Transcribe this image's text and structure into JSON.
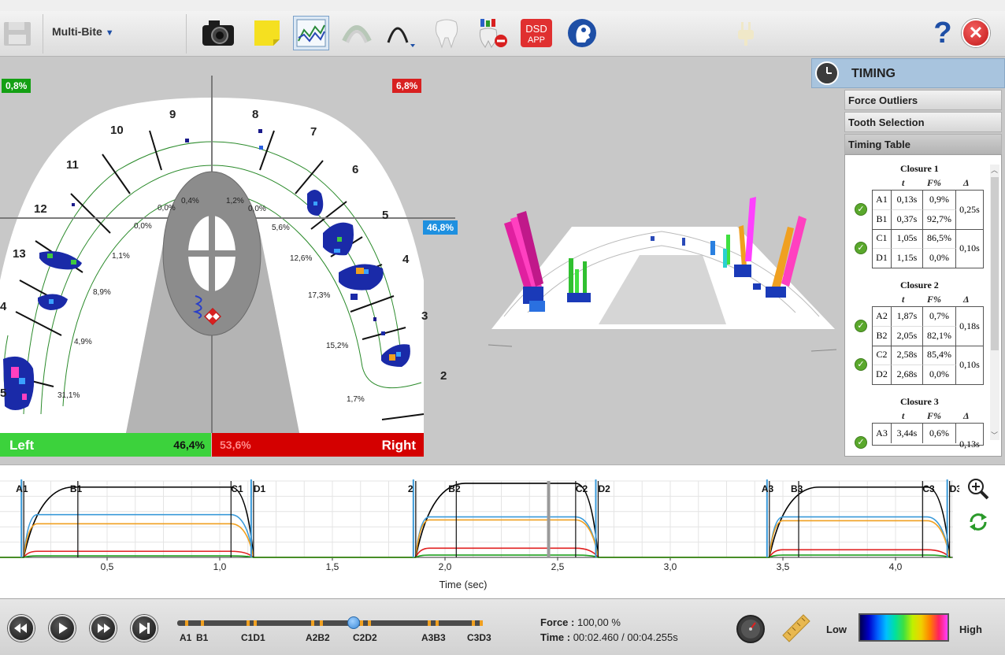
{
  "toolbar": {
    "mode_label": "Multi-Bite",
    "icons": [
      "save-icon",
      "camera-icon",
      "note-icon",
      "graph-icon",
      "arch-overlay-icon",
      "arch-curve-icon",
      "tooth-icon",
      "tooth-remove-icon",
      "dsd-app-icon",
      "head-icon",
      "plug-icon",
      "help-icon",
      "close-icon"
    ],
    "dsd_line1": "DSD",
    "dsd_line2": "APP",
    "help_glyph": "?",
    "close_glyph": "✕"
  },
  "arch": {
    "top_left_pct": "0,8%",
    "top_right_pct": "6,8%",
    "right_side_pct": "46,8%",
    "tooth_numbers": [
      "9",
      "8",
      "10",
      "7",
      "11",
      "6",
      "12",
      "5",
      "13",
      "4",
      "4",
      "3",
      "5",
      "2"
    ],
    "region_pcts": [
      "0,4%",
      "1,2%",
      "0,0%",
      "0,0%",
      "0,0%",
      "5,6%",
      "1,1%",
      "12,6%",
      "8,9%",
      "17,3%",
      "4,9%",
      "15,2%",
      "31,1%",
      "1,7%"
    ],
    "colors": {
      "left": "#3cd23c",
      "right": "#d40000",
      "badge_blue": "#1e90e0",
      "badge_green": "#13a013"
    }
  },
  "balance": {
    "left_label": "Left",
    "left_value": "46,4%",
    "right_value": "53,6%",
    "right_label": "Right"
  },
  "timing_panel": {
    "title": "TIMING",
    "sections": [
      "Force Outliers",
      "Tooth Selection",
      "Timing Table"
    ],
    "col_t": "t",
    "col_f": "F%",
    "col_delta": "Δ",
    "closures": [
      {
        "title": "Closure 1",
        "rows": [
          {
            "label": "A1",
            "t": "0,13s",
            "f": "0,9%"
          },
          {
            "label": "B1",
            "t": "0,37s",
            "f": "92,7%"
          },
          {
            "label": "C1",
            "t": "1,05s",
            "f": "86,5%"
          },
          {
            "label": "D1",
            "t": "1,15s",
            "f": "0,0%"
          }
        ],
        "deltas": [
          "0,25s",
          "0,10s"
        ]
      },
      {
        "title": "Closure 2",
        "rows": [
          {
            "label": "A2",
            "t": "1,87s",
            "f": "0,7%"
          },
          {
            "label": "B2",
            "t": "2,05s",
            "f": "82,1%"
          },
          {
            "label": "C2",
            "t": "2,58s",
            "f": "85,4%"
          },
          {
            "label": "D2",
            "t": "2,68s",
            "f": "0,0%"
          }
        ],
        "deltas": [
          "0,18s",
          "0,10s"
        ]
      },
      {
        "title": "Closure 3",
        "rows": [
          {
            "label": "A3",
            "t": "3,44s",
            "f": "0,6%"
          }
        ],
        "deltas": [
          "0,13s"
        ]
      }
    ]
  },
  "chart_data": {
    "type": "line",
    "xlabel": "Time (sec)",
    "ylabel": "",
    "xlim": [
      0,
      4.25
    ],
    "ylim": [
      0,
      100
    ],
    "x_ticks": [
      0.5,
      1.0,
      1.5,
      2.0,
      2.5,
      3.0,
      3.5,
      4.0
    ],
    "tick_labels": [
      "0,5",
      "1,0",
      "1,5",
      "2,0",
      "2,5",
      "3,0",
      "3,5",
      "4,0"
    ],
    "cursor_time": 2.46,
    "markers": [
      {
        "label": "A1",
        "t": 0.13
      },
      {
        "label": "B1",
        "t": 0.37
      },
      {
        "label": "C1",
        "t": 1.05
      },
      {
        "label": "D1",
        "t": 1.15
      },
      {
        "label": "A2",
        "t": 1.87
      },
      {
        "label": "B2",
        "t": 2.05
      },
      {
        "label": "C2",
        "t": 2.58
      },
      {
        "label": "D2",
        "t": 2.68
      },
      {
        "label": "A3",
        "t": 3.44
      },
      {
        "label": "B3",
        "t": 3.57
      },
      {
        "label": "C3",
        "t": 4.12
      },
      {
        "label": "D3",
        "t": 4.24
      }
    ],
    "marker_labels_shown": [
      "A1",
      "B1",
      "C1",
      "D1",
      "2",
      "B2",
      "C2",
      "D2",
      "A3",
      "B3",
      "C3",
      "D3"
    ],
    "series": [
      {
        "color": "#000000",
        "values_desc": "total force",
        "plateaus": [
          [
            0.13,
            1.15,
            92
          ],
          [
            1.87,
            2.68,
            97
          ],
          [
            3.44,
            4.24,
            92
          ]
        ]
      },
      {
        "color": "#3a9ad9",
        "values_desc": "blue",
        "plateaus": [
          [
            0.13,
            1.15,
            56
          ],
          [
            1.87,
            2.68,
            53
          ],
          [
            3.44,
            4.24,
            53
          ]
        ]
      },
      {
        "color": "#f0a020",
        "values_desc": "orange",
        "plateaus": [
          [
            0.13,
            1.15,
            44
          ],
          [
            1.87,
            2.68,
            49
          ],
          [
            3.44,
            4.24,
            48
          ]
        ]
      },
      {
        "color": "#e02020",
        "values_desc": "red",
        "plateaus": [
          [
            0.13,
            1.15,
            8
          ],
          [
            1.87,
            2.68,
            12
          ],
          [
            3.44,
            4.24,
            10
          ]
        ]
      },
      {
        "color": "#20a020",
        "values_desc": "green",
        "plateaus": [
          [
            0.13,
            1.15,
            2
          ],
          [
            1.87,
            2.68,
            3
          ],
          [
            3.44,
            4.24,
            3
          ]
        ]
      }
    ]
  },
  "controls": {
    "timeline_labels": [
      "A1",
      "B1",
      "C1D1",
      "A2B2",
      "C2D2",
      "A3B3",
      "C3D3"
    ],
    "force_label": "Force :",
    "force_value": "100,00 %",
    "time_label": "Time :",
    "time_value": "00:02.460 / 00:04.255s",
    "low_label": "Low",
    "high_label": "High"
  }
}
